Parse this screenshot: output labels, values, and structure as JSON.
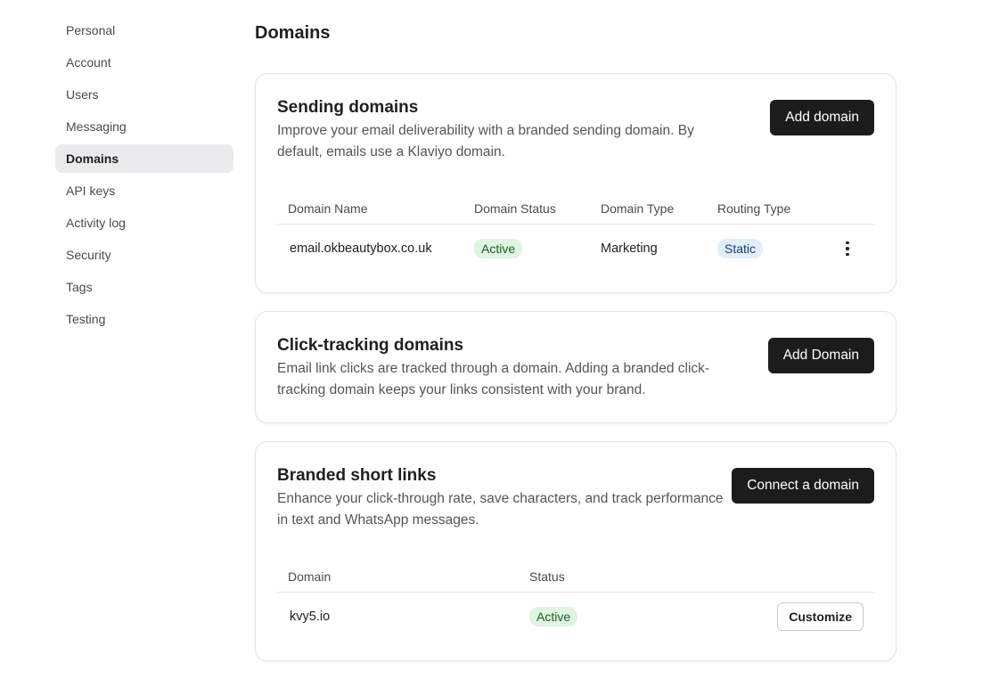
{
  "sidebar": {
    "items": [
      {
        "label": "Personal"
      },
      {
        "label": "Account"
      },
      {
        "label": "Users"
      },
      {
        "label": "Messaging"
      },
      {
        "label": "Domains",
        "active": true
      },
      {
        "label": "API keys"
      },
      {
        "label": "Activity log"
      },
      {
        "label": "Security"
      },
      {
        "label": "Tags"
      },
      {
        "label": "Testing"
      }
    ]
  },
  "page": {
    "title": "Domains"
  },
  "sending": {
    "title": "Sending domains",
    "description": "Improve your email deliverability with a branded sending domain. By default, emails use a Klaviyo domain.",
    "button": "Add domain",
    "columns": [
      "Domain Name",
      "Domain Status",
      "Domain Type",
      "Routing Type"
    ],
    "rows": [
      {
        "name": "email.okbeautybox.co.uk",
        "status": "Active",
        "type": "Marketing",
        "routing": "Static",
        "menu_icon": "more-vertical-icon"
      }
    ]
  },
  "click_tracking": {
    "title": "Click-tracking domains",
    "description": "Email link clicks are tracked through a domain. Adding a branded click-tracking domain keeps your links consistent with your brand.",
    "button": "Add Domain"
  },
  "short_links": {
    "title": "Branded short links",
    "description": "Enhance your click-through rate, save characters, and track performance in text and WhatsApp messages.",
    "button": "Connect a domain",
    "columns": [
      "Domain",
      "Status"
    ],
    "rows": [
      {
        "domain": "kvy5.io",
        "status": "Active",
        "action": "Customize"
      }
    ]
  },
  "colors": {
    "button_dark": "#1c1c1c",
    "badge_green_bg": "#dff4e1",
    "badge_blue_bg": "#e3eefb",
    "nav_active_bg": "#ebebed"
  }
}
